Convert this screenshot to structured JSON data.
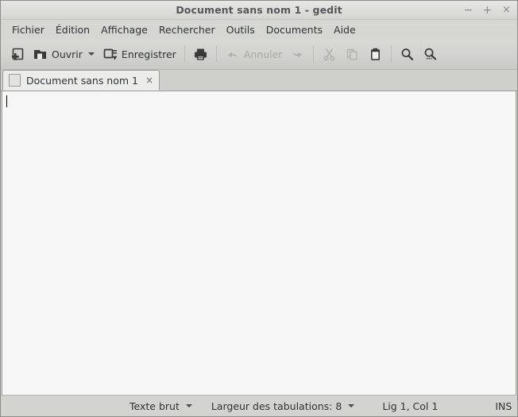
{
  "window": {
    "title": "Document sans nom 1 - gedit",
    "controls": {
      "minimize": "−",
      "maximize": "+",
      "close": "×"
    }
  },
  "menubar": {
    "items": [
      {
        "label": "Fichier"
      },
      {
        "label": "Édition"
      },
      {
        "label": "Affichage"
      },
      {
        "label": "Rechercher"
      },
      {
        "label": "Outils"
      },
      {
        "label": "Documents"
      },
      {
        "label": "Aide"
      }
    ]
  },
  "toolbar": {
    "new_label": "",
    "open_label": "Ouvrir",
    "save_label": "Enregistrer",
    "print_label": "",
    "undo_label": "Annuler",
    "redo_label": "",
    "cut_label": "",
    "copy_label": "",
    "paste_label": "",
    "find_label": "",
    "replace_label": ""
  },
  "tabs": [
    {
      "label": "Document sans nom 1",
      "close": "×"
    }
  ],
  "editor": {
    "content": ""
  },
  "statusbar": {
    "language": "Texte brut",
    "tab_width": "Largeur des tabulations: 8",
    "position": "Lig 1, Col 1",
    "insert_mode": "INS"
  },
  "colors": {
    "titlebar_text": "#54585a",
    "window_bg": "#d6d6d3",
    "toolbar_bg": "#d2d2cf",
    "editor_bg": "#f7f7f7",
    "tab_active_bg": "#ececeb",
    "statusbar_bg": "#d3d3d0",
    "icon_dark": "#3a3a38",
    "icon_disabled": "#b0b0ad"
  }
}
